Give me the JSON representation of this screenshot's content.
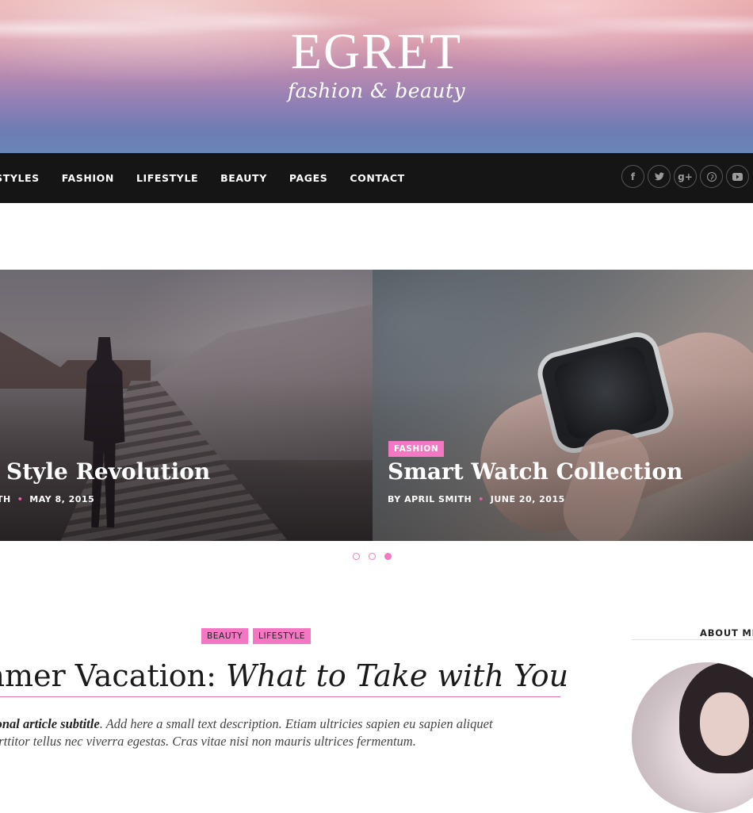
{
  "header": {
    "title": "EGRET",
    "tagline": "fashion & beauty"
  },
  "nav": {
    "items": [
      "E STYLES",
      "FASHION",
      "LIFESTYLE",
      "BEAUTY",
      "PAGES",
      "CONTACT"
    ],
    "social": [
      "f",
      "t",
      "g+",
      "p",
      "yt"
    ]
  },
  "slider": {
    "slides": [
      {
        "title": "Style Revolution",
        "author": "TH",
        "date": "MAY 8, 2015"
      },
      {
        "category": "FASHION",
        "title": "Smart Watch Collection",
        "author": "BY APRIL SMITH",
        "date": "JUNE 20, 2015"
      }
    ],
    "active_index": 2,
    "dot_count": 3
  },
  "article": {
    "tags": [
      "BEAUTY",
      "LIFESTYLE"
    ],
    "title_plain": "mmer Vacation:",
    "title_italic": "What to Take with You",
    "subtitle": "ional article subtitle",
    "body_line1": ". Add here a small text description. Etiam ultricies sapien eu sapien aliquet",
    "body_line2": "orttitor tellus nec viverra egestas. Cras vitae nisi non mauris ultrices fermentum."
  },
  "sidebar": {
    "about_heading": "ABOUT ME"
  },
  "colors": {
    "accent": "#f477c3",
    "nav_bg": "#151515"
  }
}
